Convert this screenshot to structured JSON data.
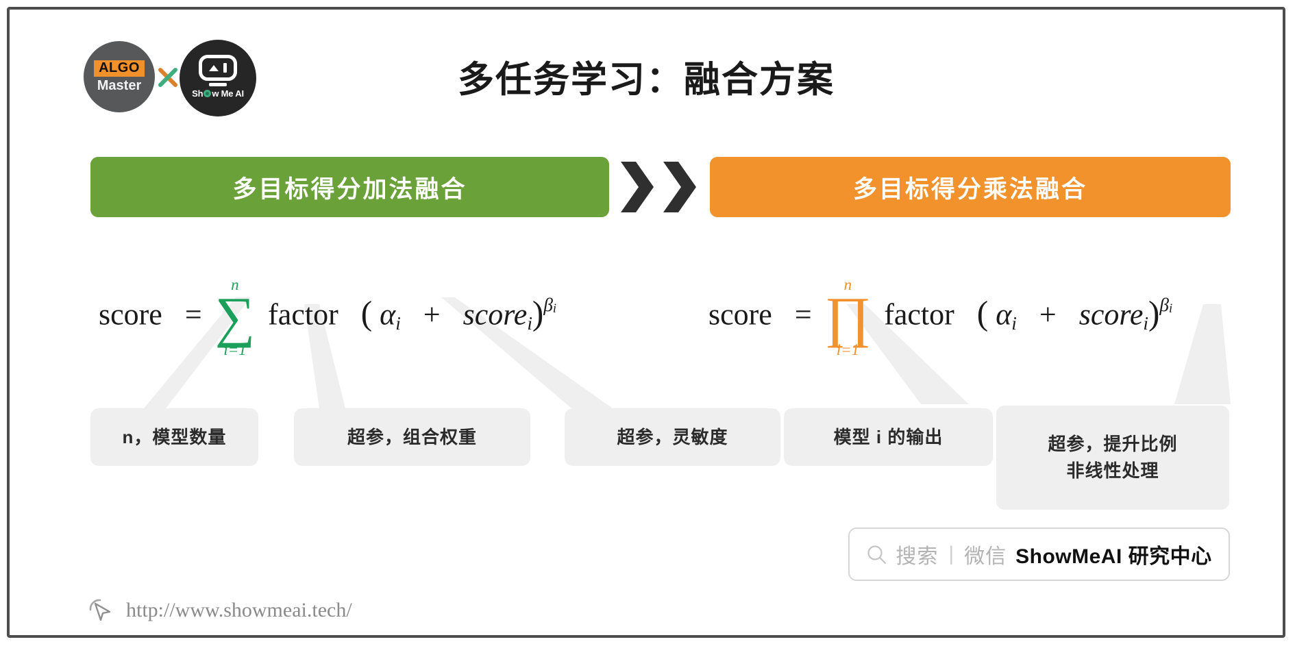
{
  "brand": {
    "logo_left_top": "ALGO",
    "logo_left_bottom": "Master",
    "logo_separator": "x",
    "logo_right_text_1": "Sh",
    "logo_right_text_2": "w Me AI"
  },
  "header": {
    "title": "多任务学习：融合方案"
  },
  "banners": {
    "left_label": "多目标得分加法融合",
    "right_label": "多目标得分乘法融合",
    "left_color": "#6ba139",
    "right_color": "#f2922d",
    "arrow_icon": "double-chevron-right-icon"
  },
  "formulas": [
    {
      "id": "additive",
      "lhs": "score",
      "equals": "=",
      "operator_glyph": "∑",
      "operator_name": "summation",
      "operator_color": "#1aa05a",
      "upper_limit": "n",
      "lower_limit": "i=1",
      "body_factor": "factor",
      "open_paren": "(",
      "alpha": "α",
      "alpha_sub": "i",
      "plus": "+",
      "score_term": "score",
      "score_sub": "i",
      "close_paren": ")",
      "beta_sup": "β",
      "beta_sup_sub": "i"
    },
    {
      "id": "multiplicative",
      "lhs": "score",
      "equals": "=",
      "operator_glyph": "∏",
      "operator_name": "product",
      "operator_color": "#f2922d",
      "upper_limit": "n",
      "lower_limit": "i=1",
      "body_factor": "factor",
      "open_paren": "(",
      "alpha": "α",
      "alpha_sub": "i",
      "plus": "+",
      "score_term": "score",
      "score_sub": "i",
      "close_paren": ")",
      "beta_sup": "β",
      "beta_sup_sub": "i"
    }
  ],
  "callouts": [
    {
      "id": "n-count",
      "line1": "n，模型数量",
      "line2": ""
    },
    {
      "id": "alpha-weight",
      "line1": "超参，组合权重",
      "line2": ""
    },
    {
      "id": "beta-sens",
      "line1": "超参，灵敏度",
      "line2": ""
    },
    {
      "id": "model-out",
      "line1": "模型 i 的输出",
      "line2": ""
    },
    {
      "id": "beta-boost",
      "line1": "超参，提升比例",
      "line2": "非线性处理"
    }
  ],
  "watermark": {
    "search_icon": "magnifier-icon",
    "search_label": "搜索",
    "divider": "|",
    "channel_label": "微信",
    "brand_name": "ShowMeAI 研究中心"
  },
  "footer": {
    "cursor_icon": "mouse-pointer-icon",
    "url": "http://www.showmeai.tech/"
  }
}
